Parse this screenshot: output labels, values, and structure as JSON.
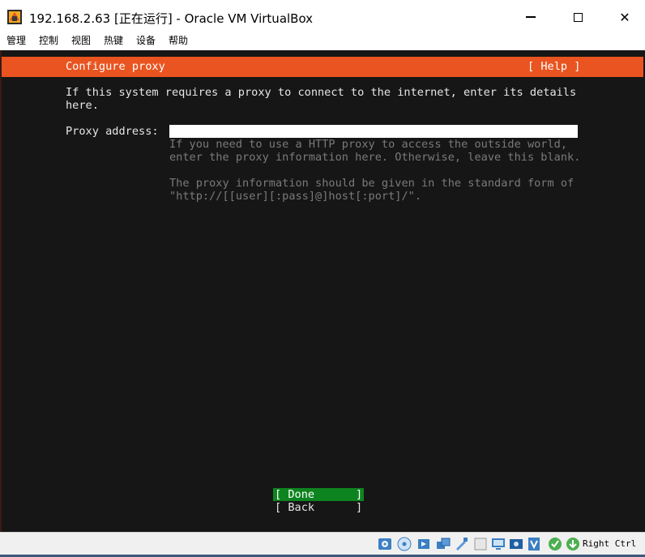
{
  "window": {
    "title": "192.168.2.63 [正在运行] - Oracle VM VirtualBox",
    "controls": {
      "minimize": "minimize",
      "maximize": "maximize",
      "close": "✕"
    }
  },
  "menu": {
    "items": [
      "管理",
      "控制",
      "视图",
      "热键",
      "设备",
      "帮助"
    ]
  },
  "installer": {
    "header_title": "Configure proxy",
    "help_label": "[ Help ]",
    "intro_line1": "If this system requires a proxy to connect to the internet, enter its details",
    "intro_line2": "here.",
    "proxy_label": "Proxy address:",
    "proxy_value": "",
    "help_line1": "If you need to use a HTTP proxy to access the outside world,",
    "help_line2": "enter the proxy information here. Otherwise, leave this blank.",
    "help_line3": "The proxy information should be given in the standard form of",
    "help_line4": "\"http://[[user][:pass]@]host[:port]/\".",
    "done_left": "[ Done",
    "done_right": "]",
    "back_left": "[ Back",
    "back_right": "]"
  },
  "statusbar": {
    "icons": [
      "hard-disk-icon",
      "optical-drive-icon",
      "audio-icon",
      "network-icon",
      "usb-icon",
      "shared-folders-icon",
      "display-icon",
      "video-capture-icon",
      "virtualization-icon",
      "mouse-integration-icon",
      "keyboard-icon"
    ],
    "host_key": "Right Ctrl"
  },
  "colors": {
    "accent": "#e95420",
    "done_button": "#0e8420",
    "vm_background": "#161616"
  }
}
